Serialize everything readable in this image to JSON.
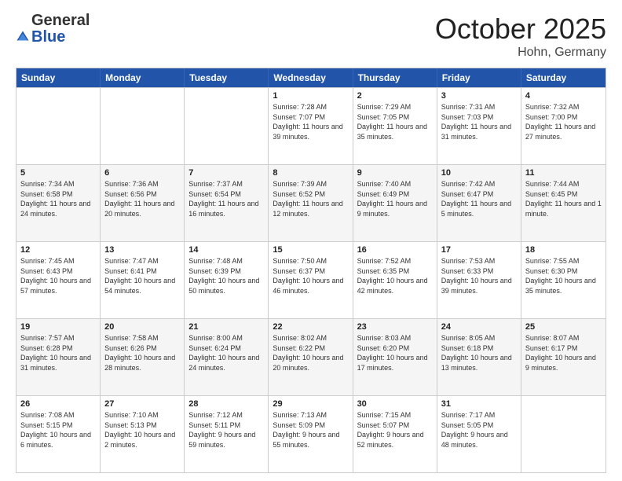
{
  "header": {
    "logo_general": "General",
    "logo_blue": "Blue",
    "month_title": "October 2025",
    "location": "Hohn, Germany"
  },
  "days_of_week": [
    "Sunday",
    "Monday",
    "Tuesday",
    "Wednesday",
    "Thursday",
    "Friday",
    "Saturday"
  ],
  "rows": [
    {
      "alt": false,
      "cells": [
        {
          "day": "",
          "text": ""
        },
        {
          "day": "",
          "text": ""
        },
        {
          "day": "",
          "text": ""
        },
        {
          "day": "1",
          "text": "Sunrise: 7:28 AM\nSunset: 7:07 PM\nDaylight: 11 hours and 39 minutes."
        },
        {
          "day": "2",
          "text": "Sunrise: 7:29 AM\nSunset: 7:05 PM\nDaylight: 11 hours and 35 minutes."
        },
        {
          "day": "3",
          "text": "Sunrise: 7:31 AM\nSunset: 7:03 PM\nDaylight: 11 hours and 31 minutes."
        },
        {
          "day": "4",
          "text": "Sunrise: 7:32 AM\nSunset: 7:00 PM\nDaylight: 11 hours and 27 minutes."
        }
      ]
    },
    {
      "alt": true,
      "cells": [
        {
          "day": "5",
          "text": "Sunrise: 7:34 AM\nSunset: 6:58 PM\nDaylight: 11 hours and 24 minutes."
        },
        {
          "day": "6",
          "text": "Sunrise: 7:36 AM\nSunset: 6:56 PM\nDaylight: 11 hours and 20 minutes."
        },
        {
          "day": "7",
          "text": "Sunrise: 7:37 AM\nSunset: 6:54 PM\nDaylight: 11 hours and 16 minutes."
        },
        {
          "day": "8",
          "text": "Sunrise: 7:39 AM\nSunset: 6:52 PM\nDaylight: 11 hours and 12 minutes."
        },
        {
          "day": "9",
          "text": "Sunrise: 7:40 AM\nSunset: 6:49 PM\nDaylight: 11 hours and 9 minutes."
        },
        {
          "day": "10",
          "text": "Sunrise: 7:42 AM\nSunset: 6:47 PM\nDaylight: 11 hours and 5 minutes."
        },
        {
          "day": "11",
          "text": "Sunrise: 7:44 AM\nSunset: 6:45 PM\nDaylight: 11 hours and 1 minute."
        }
      ]
    },
    {
      "alt": false,
      "cells": [
        {
          "day": "12",
          "text": "Sunrise: 7:45 AM\nSunset: 6:43 PM\nDaylight: 10 hours and 57 minutes."
        },
        {
          "day": "13",
          "text": "Sunrise: 7:47 AM\nSunset: 6:41 PM\nDaylight: 10 hours and 54 minutes."
        },
        {
          "day": "14",
          "text": "Sunrise: 7:48 AM\nSunset: 6:39 PM\nDaylight: 10 hours and 50 minutes."
        },
        {
          "day": "15",
          "text": "Sunrise: 7:50 AM\nSunset: 6:37 PM\nDaylight: 10 hours and 46 minutes."
        },
        {
          "day": "16",
          "text": "Sunrise: 7:52 AM\nSunset: 6:35 PM\nDaylight: 10 hours and 42 minutes."
        },
        {
          "day": "17",
          "text": "Sunrise: 7:53 AM\nSunset: 6:33 PM\nDaylight: 10 hours and 39 minutes."
        },
        {
          "day": "18",
          "text": "Sunrise: 7:55 AM\nSunset: 6:30 PM\nDaylight: 10 hours and 35 minutes."
        }
      ]
    },
    {
      "alt": true,
      "cells": [
        {
          "day": "19",
          "text": "Sunrise: 7:57 AM\nSunset: 6:28 PM\nDaylight: 10 hours and 31 minutes."
        },
        {
          "day": "20",
          "text": "Sunrise: 7:58 AM\nSunset: 6:26 PM\nDaylight: 10 hours and 28 minutes."
        },
        {
          "day": "21",
          "text": "Sunrise: 8:00 AM\nSunset: 6:24 PM\nDaylight: 10 hours and 24 minutes."
        },
        {
          "day": "22",
          "text": "Sunrise: 8:02 AM\nSunset: 6:22 PM\nDaylight: 10 hours and 20 minutes."
        },
        {
          "day": "23",
          "text": "Sunrise: 8:03 AM\nSunset: 6:20 PM\nDaylight: 10 hours and 17 minutes."
        },
        {
          "day": "24",
          "text": "Sunrise: 8:05 AM\nSunset: 6:18 PM\nDaylight: 10 hours and 13 minutes."
        },
        {
          "day": "25",
          "text": "Sunrise: 8:07 AM\nSunset: 6:17 PM\nDaylight: 10 hours and 9 minutes."
        }
      ]
    },
    {
      "alt": false,
      "cells": [
        {
          "day": "26",
          "text": "Sunrise: 7:08 AM\nSunset: 5:15 PM\nDaylight: 10 hours and 6 minutes."
        },
        {
          "day": "27",
          "text": "Sunrise: 7:10 AM\nSunset: 5:13 PM\nDaylight: 10 hours and 2 minutes."
        },
        {
          "day": "28",
          "text": "Sunrise: 7:12 AM\nSunset: 5:11 PM\nDaylight: 9 hours and 59 minutes."
        },
        {
          "day": "29",
          "text": "Sunrise: 7:13 AM\nSunset: 5:09 PM\nDaylight: 9 hours and 55 minutes."
        },
        {
          "day": "30",
          "text": "Sunrise: 7:15 AM\nSunset: 5:07 PM\nDaylight: 9 hours and 52 minutes."
        },
        {
          "day": "31",
          "text": "Sunrise: 7:17 AM\nSunset: 5:05 PM\nDaylight: 9 hours and 48 minutes."
        },
        {
          "day": "",
          "text": ""
        }
      ]
    }
  ]
}
